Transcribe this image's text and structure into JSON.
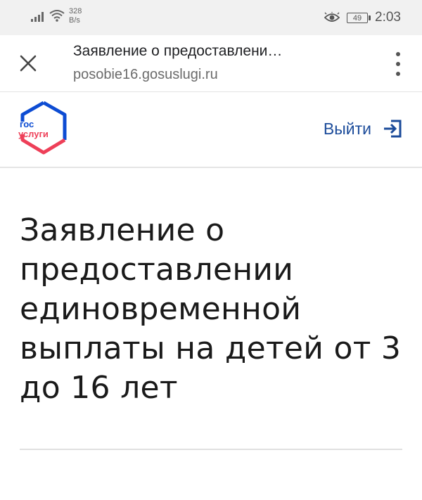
{
  "status_bar": {
    "net_speed_value": "328",
    "net_speed_unit": "B/s",
    "battery": "49",
    "time": "2:03",
    "icons": [
      "signal-icon",
      "wifi-icon",
      "eye-icon",
      "battery-icon"
    ]
  },
  "browser": {
    "page_title": "Заявление о предоставлени…",
    "url": "posobie16.gosuslugi.ru",
    "icons": [
      "close-icon",
      "more-vert-icon"
    ]
  },
  "site_header": {
    "logo_line1": "гос",
    "logo_line2": "услуги",
    "logout_label": "Выйти",
    "colors": {
      "logo_blue": "#0d4cd3",
      "logo_red": "#ee3f58",
      "link": "#1b4b9a"
    }
  },
  "main": {
    "title": "Заявление о предоставлении единовременной выплаты на детей от 3 до 16 лет"
  }
}
